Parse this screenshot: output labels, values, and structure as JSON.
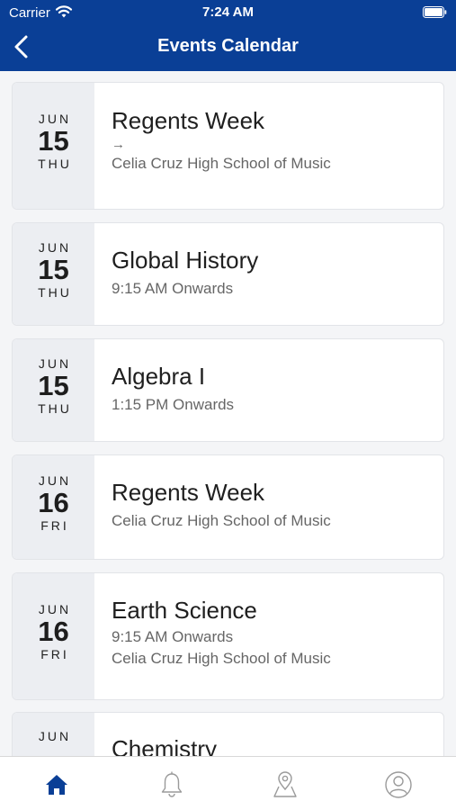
{
  "status_bar": {
    "carrier": "Carrier",
    "time": "7:24 AM"
  },
  "header": {
    "title": "Events Calendar",
    "back_icon": "chevron-left-icon"
  },
  "events": [
    {
      "month": "JUN",
      "day": "15",
      "weekday": "THU",
      "title": "Regents Week",
      "time": "",
      "arrow": "→",
      "location": "Celia Cruz High School of Music"
    },
    {
      "month": "JUN",
      "day": "15",
      "weekday": "THU",
      "title": "Global History",
      "time": "9:15 AM  Onwards",
      "arrow": "",
      "location": ""
    },
    {
      "month": "JUN",
      "day": "15",
      "weekday": "THU",
      "title": "Algebra I",
      "time": "1:15 PM  Onwards",
      "arrow": "",
      "location": ""
    },
    {
      "month": "JUN",
      "day": "16",
      "weekday": "FRI",
      "title": "Regents Week",
      "time": "",
      "arrow": "",
      "location": "Celia Cruz High School of Music"
    },
    {
      "month": "JUN",
      "day": "16",
      "weekday": "FRI",
      "title": "Earth Science",
      "time": "9:15 AM  Onwards",
      "arrow": "",
      "location": "Celia Cruz High School of Music"
    },
    {
      "month": "JUN",
      "day": "",
      "weekday": "",
      "title": "Chemistry",
      "time": "",
      "arrow": "",
      "location": ""
    }
  ],
  "tabbar": {
    "active_color": "#0a3f96",
    "inactive_color": "#9a9a9a",
    "tabs": [
      {
        "icon": "home-icon",
        "active": true
      },
      {
        "icon": "bell-icon",
        "active": false
      },
      {
        "icon": "map-pin-icon",
        "active": false
      },
      {
        "icon": "profile-icon",
        "active": false
      }
    ]
  },
  "colors": {
    "header": "#0a3f96",
    "date_column": "#eceef2",
    "background": "#f4f5f7"
  }
}
